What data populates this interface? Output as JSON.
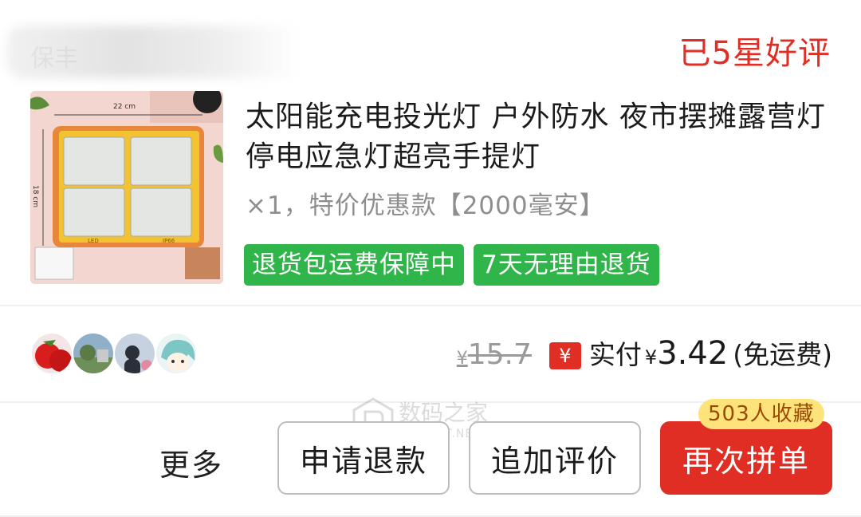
{
  "shop": {
    "name": "保丰"
  },
  "review_status": "已5星好评",
  "product": {
    "title": "太阳能充电投光灯 户外防水 夜市摆摊露营灯停电应急灯超亮手提灯",
    "spec": "×1，特价优惠款【2000毫安】",
    "image_labels": {
      "width": "22 cm",
      "height": "18 cm",
      "led": "LED",
      "ip": "IP66"
    },
    "tags": [
      "退货包运费保障中",
      "7天无理由退货"
    ]
  },
  "price": {
    "currency_symbol": "¥",
    "original": "15.7",
    "pay_badge": "¥",
    "paid_label": "实付",
    "paid_amount": "3.42",
    "shipping": "(免运费)"
  },
  "actions": {
    "more": "更多",
    "refund": "申请退款",
    "add_review": "追加评价",
    "regroup": "再次拼单",
    "favorites_badge": "503人收藏"
  },
  "watermark": {
    "text": "数码之家",
    "sub": "MYDIGIT.NET"
  },
  "colors": {
    "accent_red": "#e02e24",
    "tag_green": "#2fb54a",
    "badge_yellow": "#fde37a"
  }
}
